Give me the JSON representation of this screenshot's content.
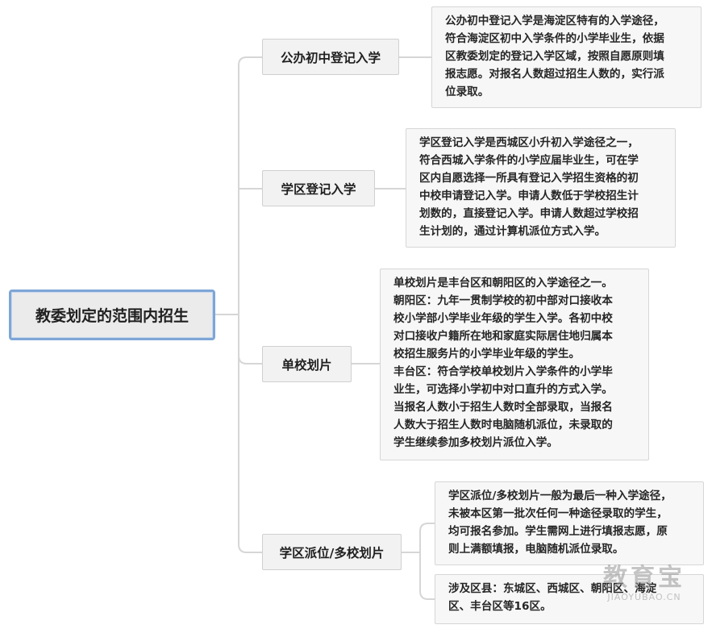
{
  "root": {
    "label": "教委划定的范围内招生"
  },
  "branches": [
    {
      "label": "公办初中登记入学",
      "notes": [
        [
          "公办初中登记入学是海淀区特有的入学途径，",
          "符合海淀区初中入学条件的小学毕业生，依据",
          "区教委划定的登记入学区域，按照自愿原则填",
          "报志愿。对报名人数超过招生人数的，实行派",
          "位录取。"
        ]
      ]
    },
    {
      "label": "学区登记入学",
      "notes": [
        [
          "学区登记入学是西城区小升初入学途径之一，",
          "符合西城入学条件的小学应届毕业生，可在学",
          "区内自愿选择一所具有登记入学招生资格的初",
          "中校申请登记入学。申请人数低于学校招生计",
          "划数的，直接登记入学。申请人数超过学校招",
          "生计划的，通过计算机派位方式入学。"
        ]
      ]
    },
    {
      "label": "单校划片",
      "notes": [
        [
          "单校划片是丰台区和朝阳区的入学途径之一。",
          "朝阳区：九年一贯制学校的初中部对口接收本",
          "校小学部小学毕业年级的学生入学。各初中校",
          "对口接收户籍所在地和家庭实际居住地归属本",
          "校招生服务片的小学毕业年级的学生。",
          "丰台区：符合学校单校划片入学条件的小学毕",
          "业生，可选择小学初中对口直升的方式入学。",
          "当报名人数小于招生人数时全部录取，当报名",
          "人数大于招生人数时电脑随机派位，未录取的",
          "学生继续参加多校划片派位入学。"
        ]
      ]
    },
    {
      "label": "学区派位/多校划片",
      "notes": [
        [
          "学区派位/多校划片一般为最后一种入学途径，",
          "未被本区第一批次任何一种途径录取的学生，",
          "均可报名参加。学生需网上进行填报志愿，原",
          "则上满额填报，电脑随机派位录取。"
        ],
        [
          "涉及区县：东城区、西城区、朝阳区、海淀",
          "区、丰台区等16区。"
        ]
      ]
    }
  ],
  "watermark": {
    "cn": "教育宝",
    "en": "JIAOYUBAO.CN"
  },
  "colors": {
    "connector": "#d6d6d6",
    "root_border": "#7ea6d6",
    "node_fill": "#f2f2f2",
    "leaf_fill": "#f7f7f7"
  }
}
